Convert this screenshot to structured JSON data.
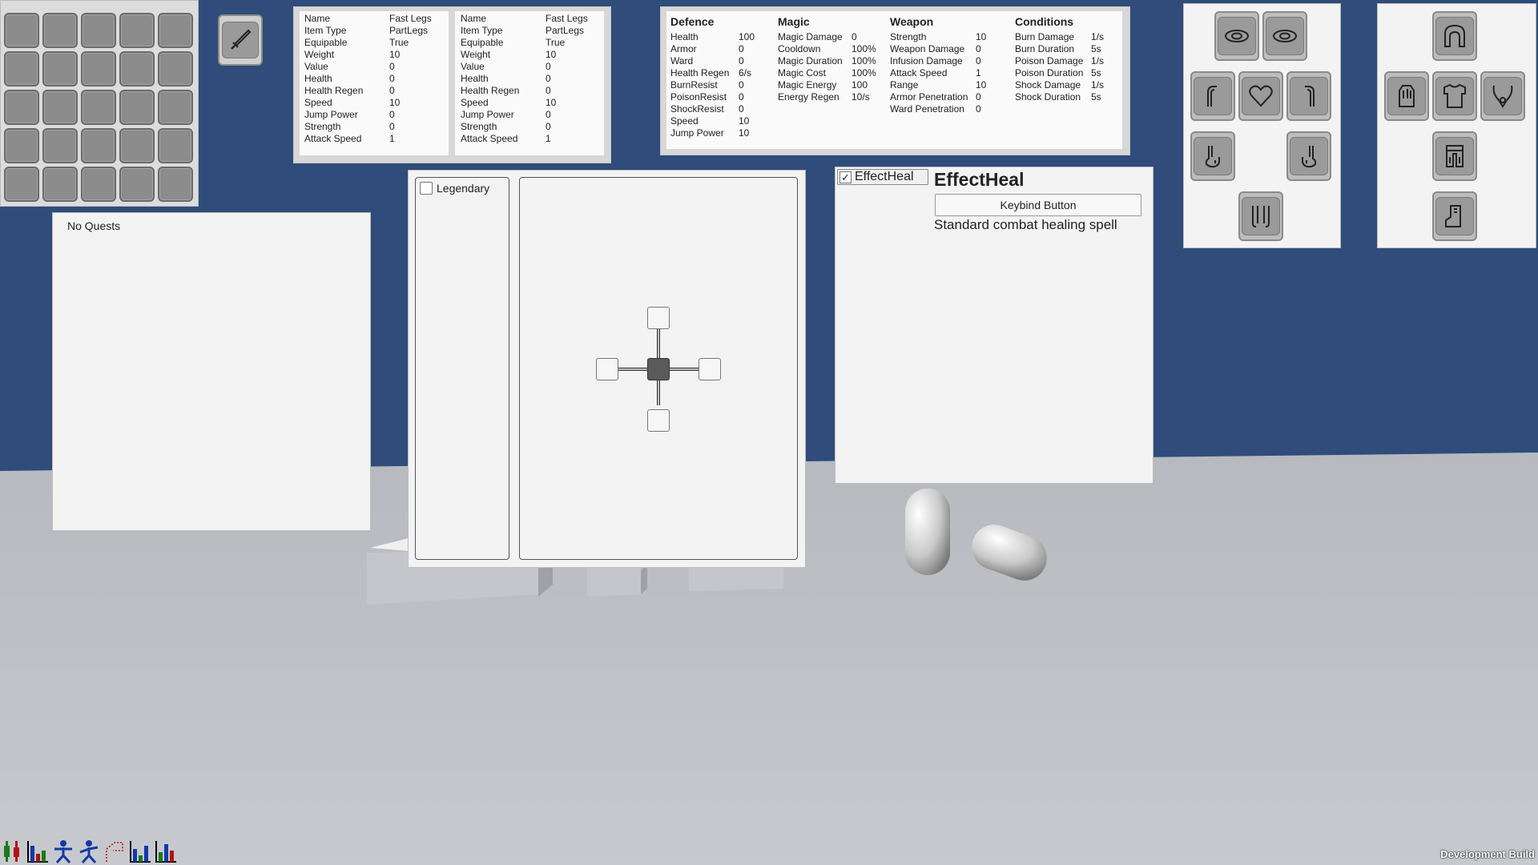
{
  "item_compare": {
    "left": [
      {
        "k": "Name",
        "v": "Fast Legs"
      },
      {
        "k": "Item Type",
        "v": "PartLegs"
      },
      {
        "k": "Equipable",
        "v": "True"
      },
      {
        "k": "Weight",
        "v": "10"
      },
      {
        "k": "Value",
        "v": "0"
      },
      {
        "k": "Health",
        "v": "0"
      },
      {
        "k": "Health Regen",
        "v": "0"
      },
      {
        "k": "Speed",
        "v": "10"
      },
      {
        "k": "Jump Power",
        "v": "0"
      },
      {
        "k": "Strength",
        "v": "0"
      },
      {
        "k": "Attack Speed",
        "v": "1"
      }
    ],
    "right": [
      {
        "k": "Name",
        "v": "Fast Legs"
      },
      {
        "k": "Item Type",
        "v": "PartLegs"
      },
      {
        "k": "Equipable",
        "v": "True"
      },
      {
        "k": "Weight",
        "v": "10"
      },
      {
        "k": "Value",
        "v": "0"
      },
      {
        "k": "Health",
        "v": "0"
      },
      {
        "k": "Health Regen",
        "v": "0"
      },
      {
        "k": "Speed",
        "v": "10"
      },
      {
        "k": "Jump Power",
        "v": "0"
      },
      {
        "k": "Strength",
        "v": "0"
      },
      {
        "k": "Attack Speed",
        "v": "1"
      }
    ]
  },
  "char_stats": {
    "defence": {
      "title": "Defence",
      "rows": [
        {
          "k": "Health",
          "v": "100"
        },
        {
          "k": "Armor",
          "v": "0"
        },
        {
          "k": "Ward",
          "v": "0"
        },
        {
          "k": "Health Regen",
          "v": "6/s"
        },
        {
          "k": "BurnResist",
          "v": "0"
        },
        {
          "k": "PoisonResist",
          "v": "0"
        },
        {
          "k": "ShockResist",
          "v": "0"
        },
        {
          "k": "Speed",
          "v": "10"
        },
        {
          "k": "Jump Power",
          "v": "10"
        }
      ]
    },
    "magic": {
      "title": "Magic",
      "rows": [
        {
          "k": "Magic Damage",
          "v": "0"
        },
        {
          "k": "Cooldown",
          "v": "100%"
        },
        {
          "k": "Magic Duration",
          "v": "100%"
        },
        {
          "k": "Magic Cost",
          "v": "100%"
        },
        {
          "k": "Magic Energy",
          "v": "100"
        },
        {
          "k": "Energy Regen",
          "v": "10/s"
        }
      ]
    },
    "weapon": {
      "title": "Weapon",
      "rows": [
        {
          "k": "Strength",
          "v": "10"
        },
        {
          "k": "Weapon Damage",
          "v": "0"
        },
        {
          "k": "Infusion Damage",
          "v": "0"
        },
        {
          "k": "Attack Speed",
          "v": "1"
        },
        {
          "k": "Range",
          "v": "10"
        },
        {
          "k": "Armor Penetration",
          "v": "0"
        },
        {
          "k": "Ward Penetration",
          "v": "0"
        }
      ]
    },
    "conditions": {
      "title": "Conditions",
      "rows": [
        {
          "k": "Burn Damage",
          "v": "1/s"
        },
        {
          "k": "Burn Duration",
          "v": "5s"
        },
        {
          "k": "Poison Damage",
          "v": "1/s"
        },
        {
          "k": "Poison Duration",
          "v": "5s"
        },
        {
          "k": "Shock Damage",
          "v": "1/s"
        },
        {
          "k": "Shock Duration",
          "v": "5s"
        }
      ]
    }
  },
  "quests": {
    "empty_text": "No Quests"
  },
  "skill_tree": {
    "filter_label": "Legendary",
    "filter_checked": false
  },
  "spell": {
    "list_item": "EffectHeal",
    "list_item_checked": true,
    "title": "EffectHeal",
    "keybind_button": "Keybind Button",
    "description": "Standard combat healing spell"
  },
  "body_slots": [
    "eye-left-icon",
    "eye-right-icon",
    "arm-left-icon",
    "heart-icon",
    "arm-right-icon",
    "hand-left-icon",
    "hand-right-icon",
    "legs-icon"
  ],
  "armor_slots": [
    "helmet-icon",
    "gauntlet-icon",
    "chest-armor-icon",
    "amulet-icon",
    "leg-armor-icon",
    "boot-icon"
  ],
  "footer": {
    "build_label": "Development Build"
  },
  "colors": {
    "sky": "#2f4c7a",
    "floor": "#b9bcc3",
    "panel": "#f3f3f3",
    "slot": "#8c8c8c"
  }
}
